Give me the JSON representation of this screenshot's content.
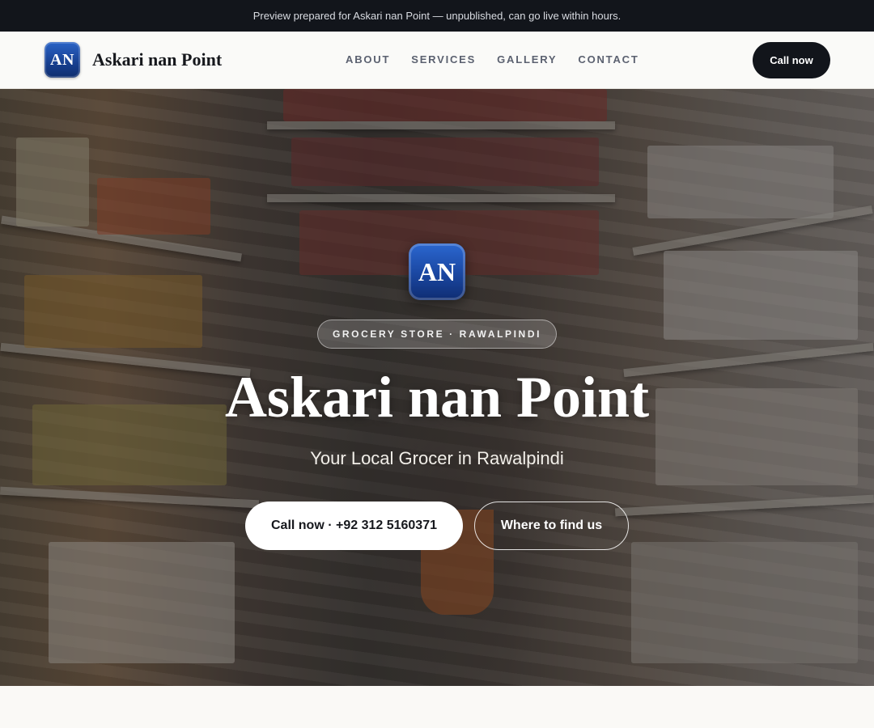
{
  "preview_notice": "Preview prepared for Askari nan Point — unpublished, can go live within hours.",
  "header": {
    "logo_initials": "AN",
    "brand_name": "Askari nan Point",
    "nav": [
      "ABOUT",
      "SERVICES",
      "GALLERY",
      "CONTACT"
    ],
    "call_label": "Call now"
  },
  "hero": {
    "logo_initials": "AN",
    "tag": "GROCERY STORE · RAWALPINDI",
    "title": "Askari nan Point",
    "subtitle": "Your Local Grocer in Rawalpindi",
    "primary_button": "Call now · +92 312 5160371",
    "secondary_button": "Where to find us"
  },
  "colors": {
    "dark": "#12151b",
    "logo_blue": "#1a46a0",
    "background": "#faf9f6"
  }
}
